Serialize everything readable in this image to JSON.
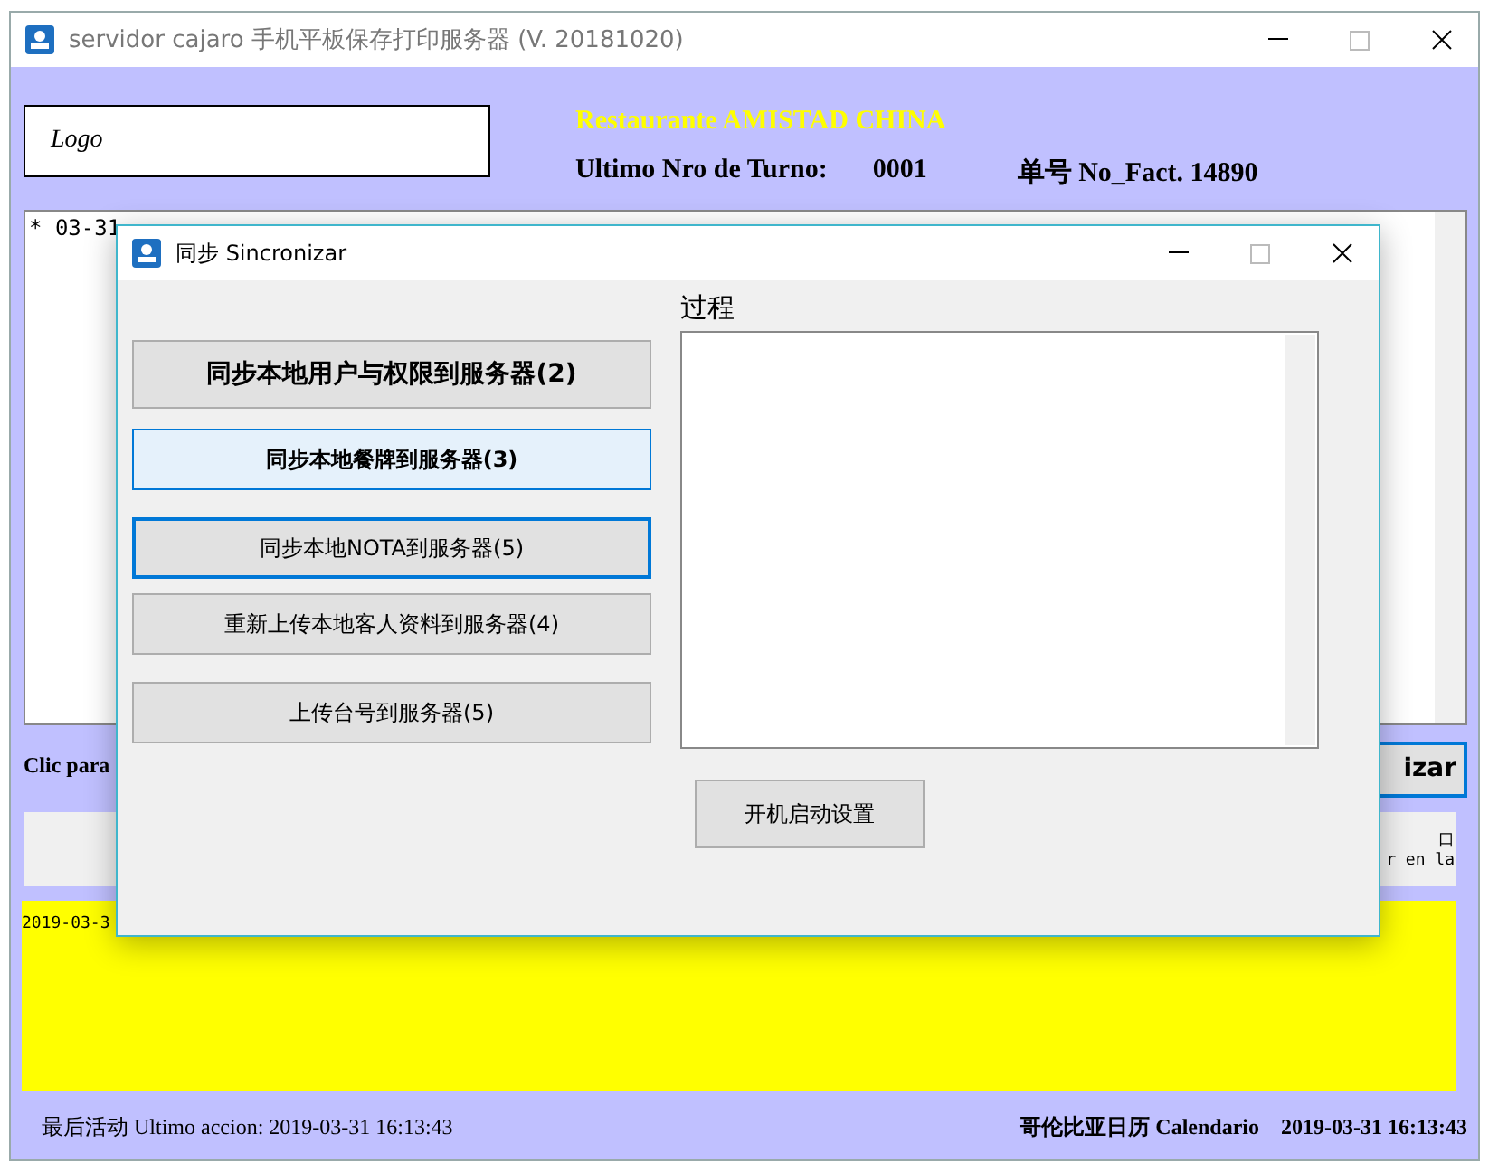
{
  "window": {
    "title": "servidor cajaro 手机平板保存打印服务器 (V. 20181020)"
  },
  "header": {
    "logo": "Logo",
    "restaurant": "Restaurante AMISTAD CHINA",
    "turn_label": "Ultimo Nro de Turno:",
    "turn_value": "0001",
    "invoice": "单号 No_Fact. 14890"
  },
  "log": {
    "text": "* 03-31"
  },
  "action_label": "Clic para",
  "action_button": "izar",
  "info_lines": [
    "口",
    "r en la"
  ],
  "yellow_log": "2019-03-3",
  "status_bar": {
    "last_action": "最后活动 Ultimo accion: 2019-03-31 16:13:43",
    "calendar": "哥伦比亚日历 Calendario",
    "clock": "2019-03-31 16:13:43"
  },
  "dialog": {
    "title": "同步 Sincronizar",
    "buttons": [
      {
        "label": "同步本地用户与权限到服务器(2)",
        "kind": "large",
        "hovered": false,
        "focused": false
      },
      {
        "label": "同步本地餐牌到服务器(3)",
        "kind": "bold",
        "hovered": true,
        "focused": false
      },
      {
        "label": "同步本地NOTA到服务器(5)",
        "kind": "normal",
        "hovered": false,
        "focused": true
      },
      {
        "label": "重新上传本地客人资料到服务器(4)",
        "kind": "normal",
        "hovered": false,
        "focused": false
      },
      {
        "label": "上传台号到服务器(5)",
        "kind": "normal",
        "hovered": false,
        "focused": false
      }
    ],
    "process_label": "过程",
    "startup_button": "开机启动设置"
  }
}
